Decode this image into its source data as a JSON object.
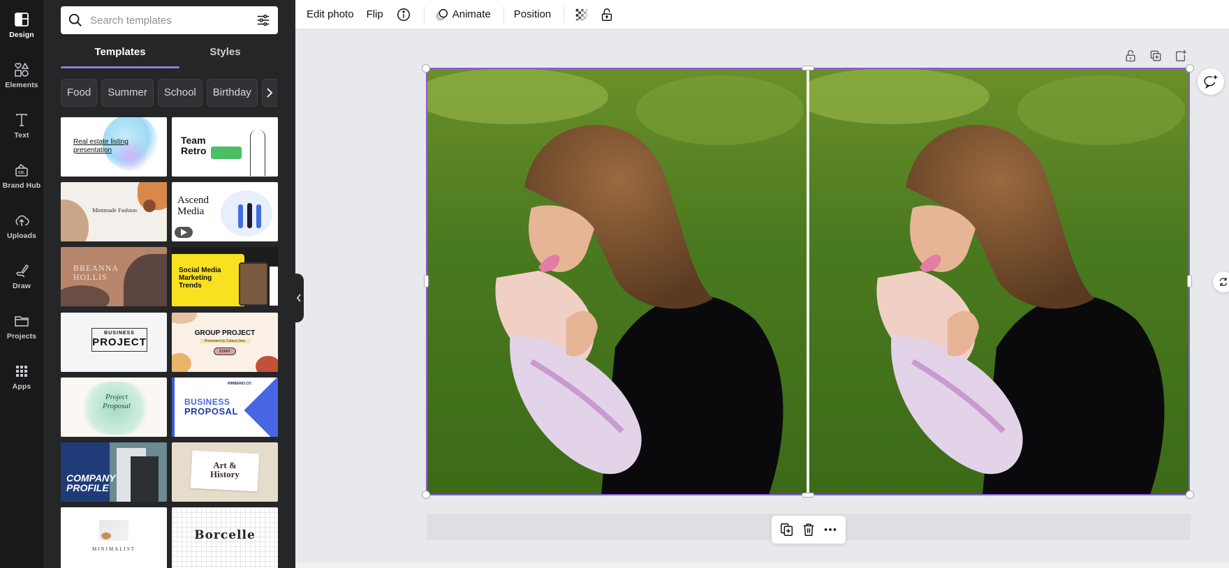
{
  "rail": {
    "items": [
      {
        "label": "Design",
        "icon": "design-layout-icon",
        "active": true
      },
      {
        "label": "Elements",
        "icon": "shapes-icon"
      },
      {
        "label": "Text",
        "icon": "text-t-icon"
      },
      {
        "label": "Brand Hub",
        "icon": "brand-briefcase-icon"
      },
      {
        "label": "Uploads",
        "icon": "cloud-upload-icon"
      },
      {
        "label": "Draw",
        "icon": "pen-draw-icon"
      },
      {
        "label": "Projects",
        "icon": "folder-icon"
      },
      {
        "label": "Apps",
        "icon": "apps-grid-icon"
      }
    ]
  },
  "panel": {
    "search": {
      "placeholder": "Search templates",
      "value": ""
    },
    "tabs": [
      {
        "label": "Templates",
        "active": true
      },
      {
        "label": "Styles"
      }
    ],
    "chips": [
      "Food",
      "Summer",
      "School",
      "Birthday"
    ],
    "templates": [
      {
        "title": "Real estate listing presentation"
      },
      {
        "title": "Team Retro"
      },
      {
        "title": "Mintmade Fashion"
      },
      {
        "title": "Ascend Media"
      },
      {
        "title": "BREANNA HOLLIS"
      },
      {
        "title": "Social Media Marketing Trends"
      },
      {
        "title": "BUSINESS PROJECT",
        "line1": "BUSINESS",
        "line2": "PROJECT"
      },
      {
        "title": "GROUP PROJECT",
        "subtitle": "Presented by Cataya Dew",
        "button": "START"
      },
      {
        "title": "Project Proposal"
      },
      {
        "title": "BUSINESS PROPOSAL",
        "line1": "BUSINESS",
        "line2": "PROPOSAL",
        "brand": "RIMBERIO.CO"
      },
      {
        "title": "COMPANY PROFILE",
        "line1": "COMPANY",
        "line2": "PROFILE"
      },
      {
        "title": "Art & History",
        "line1": "Art &",
        "line2": "History"
      },
      {
        "title": "MINIMALIST"
      },
      {
        "title": "Borcelle"
      }
    ]
  },
  "toolbar": {
    "edit_photo": "Edit photo",
    "flip": "Flip",
    "animate": "Animate",
    "position": "Position"
  },
  "colors": {
    "selection": "#8b5cd6",
    "accent_tab": "#8b7fd9",
    "panel_bg": "#252627",
    "rail_bg": "#18191b",
    "canvas_bg": "#e8e9ed"
  }
}
